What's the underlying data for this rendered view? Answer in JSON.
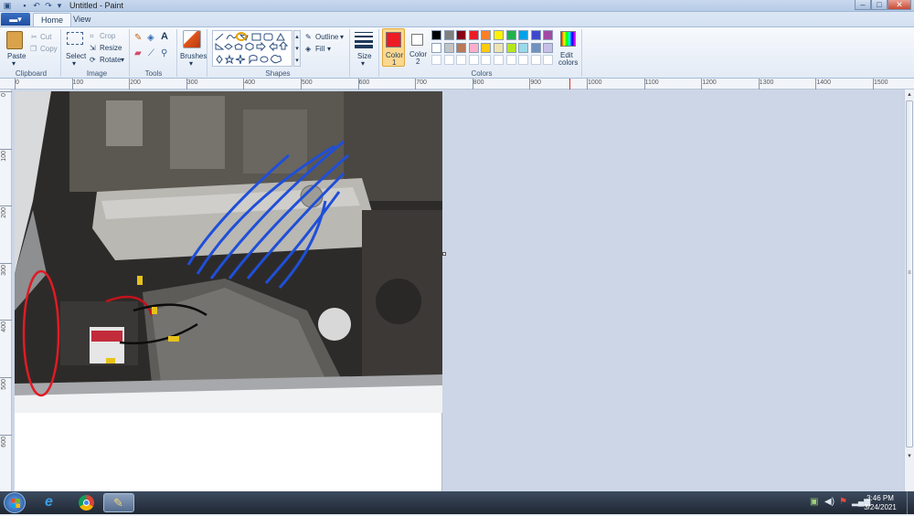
{
  "window": {
    "title": "Untitled - Paint",
    "controls": {
      "minimize": "–",
      "maximize": "□",
      "close": "✕"
    }
  },
  "tabs": {
    "file": "▬▾",
    "home": "Home",
    "view": "View"
  },
  "ribbon": {
    "clipboard": {
      "label": "Clipboard",
      "paste": "Paste",
      "cut": "Cut",
      "copy": "Copy"
    },
    "image": {
      "label": "Image",
      "select": "Select",
      "crop": "Crop",
      "resize": "Resize",
      "rotate": "Rotate"
    },
    "tools": {
      "label": "Tools"
    },
    "brushes": {
      "label": "Brushes"
    },
    "shapes": {
      "label": "Shapes",
      "outline": "Outline",
      "fill": "Fill"
    },
    "size": {
      "label": "Size"
    },
    "colors": {
      "label": "Colors",
      "color1": "Color",
      "color1_num": "1",
      "color2": "Color",
      "color2_num": "2",
      "edit": "Edit",
      "edit2": "colors",
      "color1_value": "#ed1c24",
      "palette_row1": [
        "#000000",
        "#7f7f7f",
        "#880015",
        "#ed1c24",
        "#ff7f27",
        "#fff200",
        "#22b14c",
        "#00a2e8",
        "#3f48cc",
        "#a349a4"
      ],
      "palette_row2": [
        "#ffffff",
        "#c3c3c3",
        "#b97a57",
        "#ffaec9",
        "#ffc90e",
        "#efe4b0",
        "#b5e61d",
        "#99d9ea",
        "#7092be",
        "#c8bfe7"
      ]
    }
  },
  "ruler": {
    "top": [
      "0",
      "100",
      "200",
      "300",
      "400",
      "500",
      "600",
      "700",
      "800",
      "900",
      "1000",
      "1100",
      "1200",
      "1300",
      "1400",
      "1500"
    ],
    "left": [
      "0",
      "100",
      "200",
      "300",
      "400",
      "500",
      "600"
    ]
  },
  "taskbar": {
    "time": "3:46 PM",
    "date": "3/24/2021"
  }
}
